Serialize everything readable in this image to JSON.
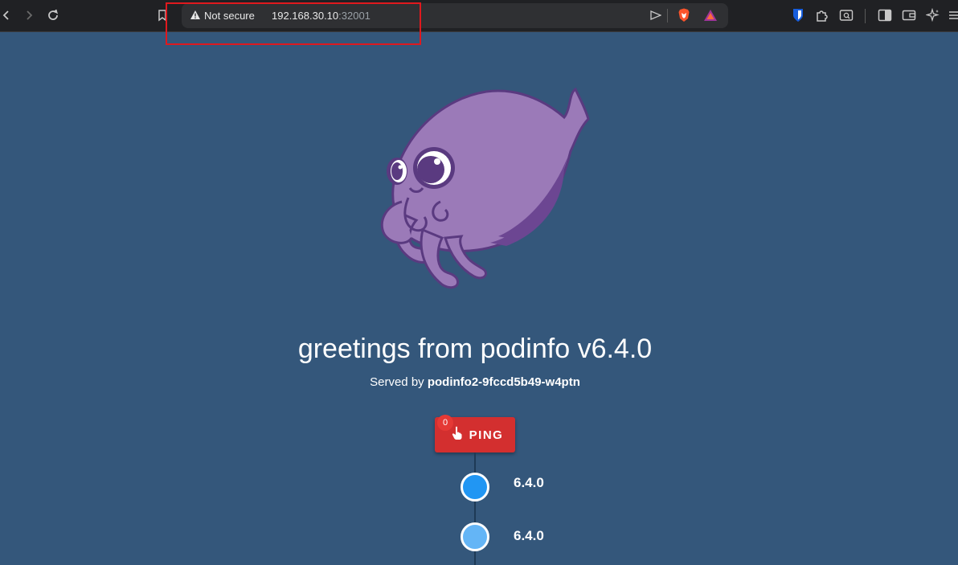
{
  "browser": {
    "security_label": "Not secure",
    "url_host": "192.168.30.10",
    "url_port": ":32001"
  },
  "page": {
    "title": "greetings from podinfo v6.4.0",
    "served_by_prefix": "Served by ",
    "served_by_host": "podinfo2-9fccd5b49-w4ptn",
    "ping_label": "PING",
    "ping_count": "0",
    "timeline": [
      {
        "version": "6.4.0",
        "color": "#2196f3"
      },
      {
        "version": "6.4.0",
        "color": "#64b5f6"
      }
    ]
  },
  "colors": {
    "background": "#34577b",
    "ping_button": "#d32f2f",
    "mascot": "#9b7ab8"
  }
}
